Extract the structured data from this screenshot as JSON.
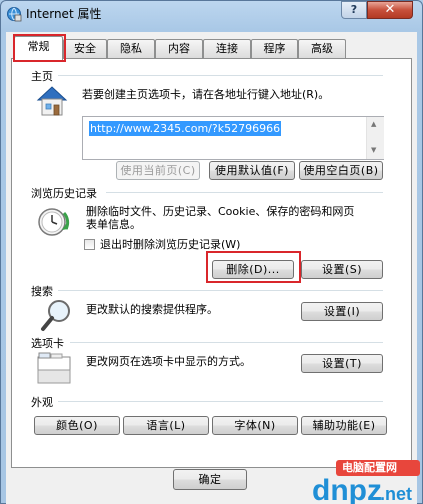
{
  "window": {
    "title": "Internet 属性",
    "help_label": "?",
    "close_label": "✕"
  },
  "tabs": [
    "常规",
    "安全",
    "隐私",
    "内容",
    "连接",
    "程序",
    "高级"
  ],
  "homepage": {
    "label": "主页",
    "description": "若要创建主页选项卡，请在各地址行键入地址(R)。",
    "url": "http://www.2345.com/?k52796966",
    "buttons": [
      "使用当前页(C)",
      "使用默认值(F)",
      "使用空白页(B)"
    ]
  },
  "history": {
    "label": "浏览历史记录",
    "description_line1": "删除临时文件、历史记录、Cookie、保存的密码和网页",
    "description_line2": "表单信息。",
    "checkbox_label": "退出时删除浏览历史记录(W)",
    "delete_button": "删除(D)...",
    "settings_button": "设置(S)"
  },
  "search": {
    "label": "搜索",
    "description": "更改默认的搜索提供程序。",
    "settings_button": "设置(I)"
  },
  "tabs_section": {
    "label": "选项卡",
    "description": "更改网页在选项卡中显示的方式。",
    "settings_button": "设置(T)"
  },
  "appearance": {
    "label": "外观",
    "buttons": [
      "颜色(O)",
      "语言(L)",
      "字体(N)",
      "辅助功能(E)"
    ]
  },
  "footer": {
    "ok_button": "确定"
  },
  "watermark": {
    "brand": "dnpz.net",
    "tag": "电脑配置网"
  },
  "colors": {
    "highlight": "#d9262b",
    "selection": "#3399ff"
  }
}
